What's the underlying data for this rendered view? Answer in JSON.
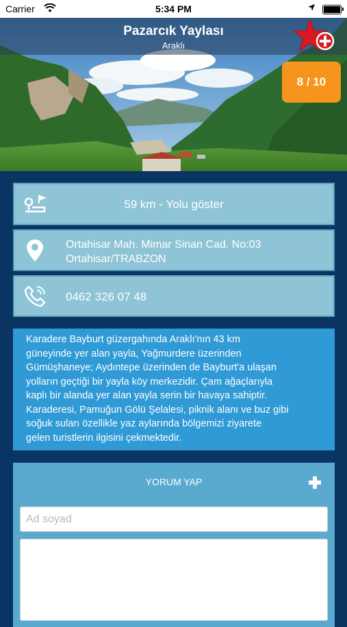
{
  "status_bar": {
    "carrier": "Carrier",
    "time": "5:34 PM"
  },
  "header": {
    "title": "Pazarcık Yaylası",
    "subtitle": "Araklı",
    "rating": "8 / 10",
    "favorite_icon": "star-plus-icon"
  },
  "info": {
    "distance": {
      "icon": "route-icon",
      "text": "59 km - Yolu göster"
    },
    "address": {
      "icon": "location-pin-icon",
      "line1": "Ortahisar Mah. Mimar Sinan Cad. No:03",
      "line2": "Ortahisar/TRABZON"
    },
    "phone": {
      "icon": "phone-icon",
      "text": "0462 326 07 48"
    }
  },
  "description": {
    "lines": [
      "Karadere Bayburt güzergahında Araklı'nın 43 km",
      "güneyinde yer alan yayla, Yağmurdere üzerinden",
      "Gümüşhaneye; Aydıntepe üzerinden de Bayburt'a ulaşan",
      "yolların geçtiği bir yayla köy merkezidir. Çam ağaçlarıyla",
      "kaplı bir alanda yer alan yayla serin bir havaya sahiptir.",
      "Karaderesi, Pamuğun Gölü Şelalesi, piknik alanı ve buz gibi",
      "soğuk suları özellikle yaz aylarında bölgemizi ziyarete",
      "gelen turistlerin ilgisini çekmektedir."
    ]
  },
  "comment": {
    "heading": "YORUM YAP",
    "name_placeholder": "Ad soyad",
    "name_value": "",
    "comment_value": ""
  },
  "colors": {
    "page_background": "#0a3461",
    "card_background": "#8ec4d6",
    "description_background": "#2f9ad6",
    "comment_panel_background": "#5aaad0",
    "rating_badge": "#f7941d",
    "favorite_star": "#d71920"
  }
}
